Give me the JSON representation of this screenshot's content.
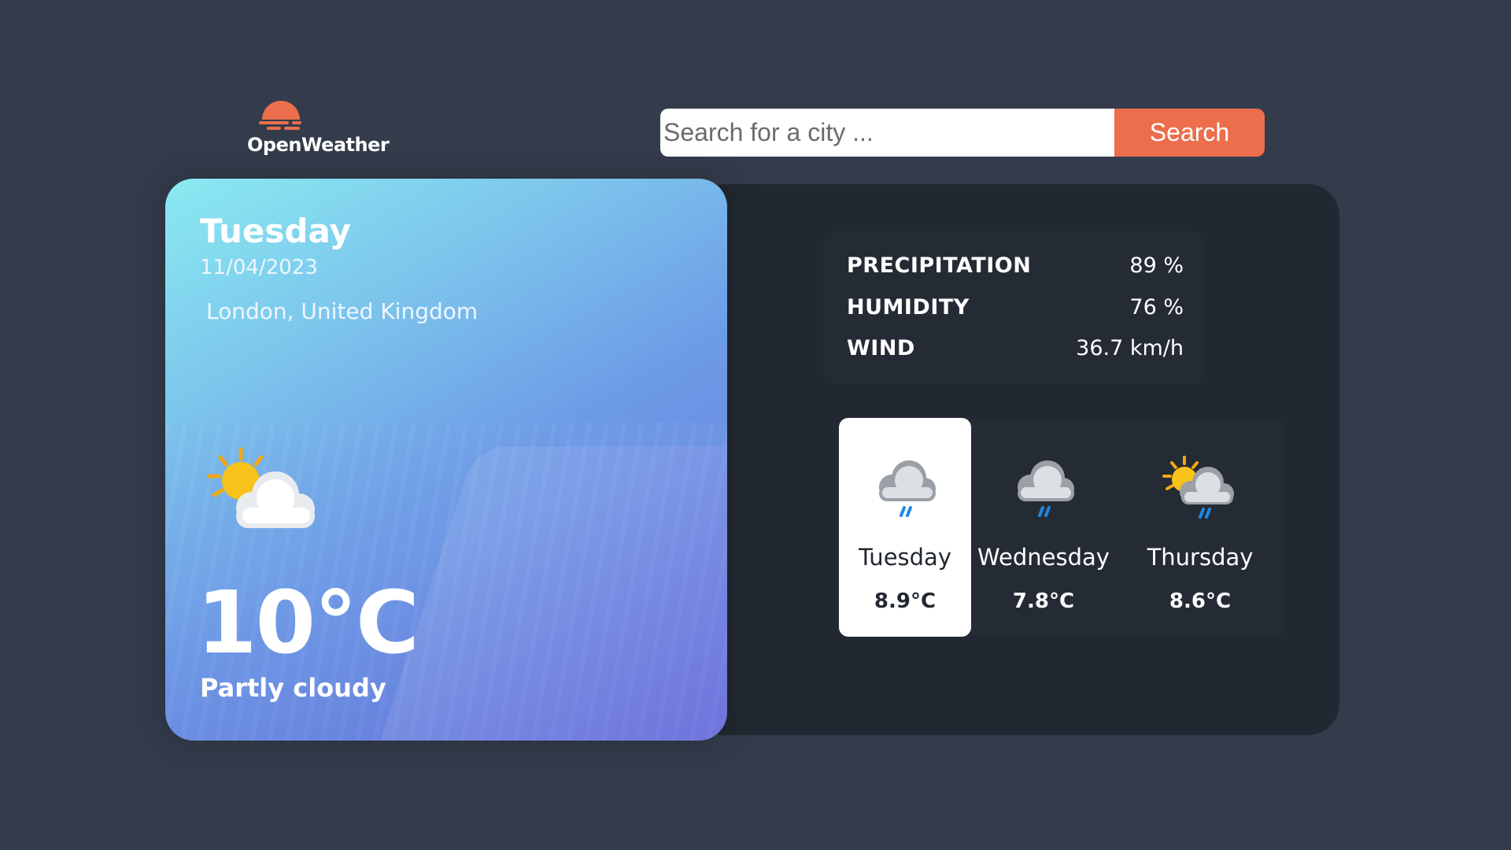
{
  "logo": {
    "text": "OpenWeather",
    "icon": "sun-setting-icon"
  },
  "search": {
    "placeholder": "Search for a city ...",
    "button_label": "Search"
  },
  "current": {
    "day": "Tuesday",
    "date": "11/04/2023",
    "location": "London, United Kingdom",
    "temperature": "10°C",
    "condition": "Partly cloudy",
    "icon": "partly-cloudy-icon"
  },
  "stats": [
    {
      "label": "PRECIPITATION",
      "value": "89 %"
    },
    {
      "label": "HUMIDITY",
      "value": "76 %"
    },
    {
      "label": "WIND",
      "value": "36.7 km/h"
    }
  ],
  "forecast": [
    {
      "day": "Tuesday",
      "temp": "8.9°C",
      "icon": "rain-cloud-icon",
      "active": true
    },
    {
      "day": "Wednesday",
      "temp": "7.8°C",
      "icon": "rain-cloud-icon",
      "active": false
    },
    {
      "day": "Thursday",
      "temp": "8.6°C",
      "icon": "sun-rain-cloud-icon",
      "active": false
    }
  ],
  "colors": {
    "background": "#343c4c",
    "panel": "#222831",
    "accent": "#ec6e4c"
  }
}
